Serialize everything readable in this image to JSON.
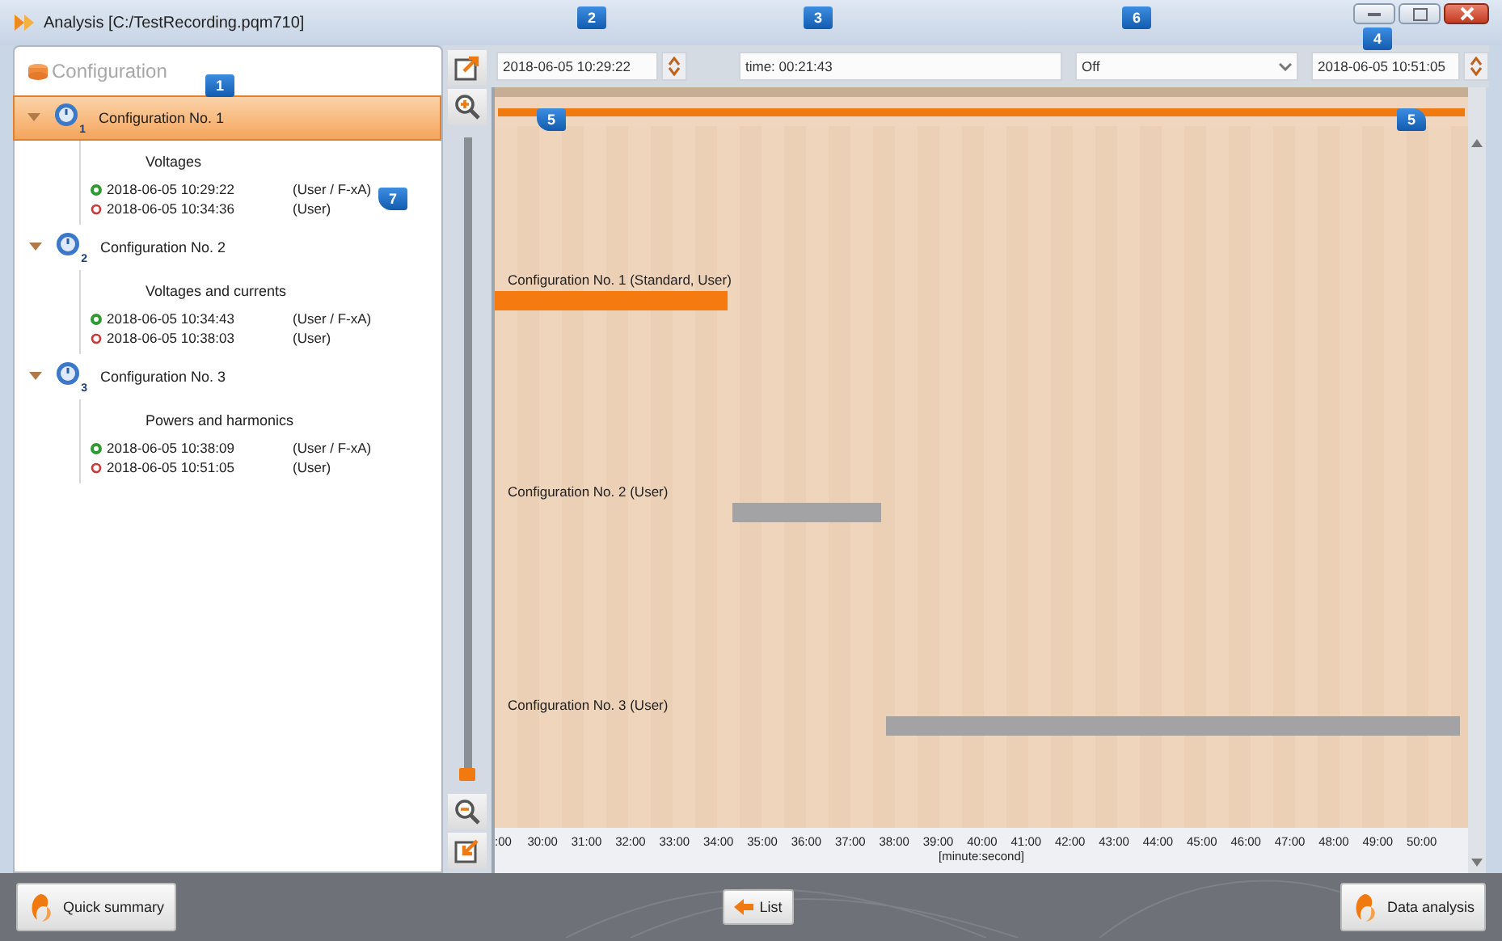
{
  "window": {
    "title": "Analysis [C:/TestRecording.pqm710]"
  },
  "sidebar": {
    "header": "Configuration",
    "items": [
      {
        "label": "Configuration No. 1",
        "number": "1",
        "expanded": true,
        "selected": true,
        "children": [
          {
            "title": "Voltages",
            "entries": [
              {
                "kind": "start",
                "time": "2018-06-05 10:29:22",
                "mode": "(User / F-xA)"
              },
              {
                "kind": "stop",
                "time": "2018-06-05 10:34:36",
                "mode": "(User)"
              }
            ]
          }
        ]
      },
      {
        "label": "Configuration No. 2",
        "number": "2",
        "expanded": true,
        "selected": false,
        "children": [
          {
            "title": "Voltages and currents",
            "entries": [
              {
                "kind": "start",
                "time": "2018-06-05 10:34:43",
                "mode": "(User / F-xA)"
              },
              {
                "kind": "stop",
                "time": "2018-06-05 10:38:03",
                "mode": "(User)"
              }
            ]
          }
        ]
      },
      {
        "label": "Configuration No. 3",
        "number": "3",
        "expanded": true,
        "selected": false,
        "children": [
          {
            "title": "Powers and harmonics",
            "entries": [
              {
                "kind": "start",
                "time": "2018-06-05 10:38:09",
                "mode": "(User / F-xA)"
              },
              {
                "kind": "stop",
                "time": "2018-06-05 10:51:05",
                "mode": "(User)"
              }
            ]
          }
        ]
      }
    ]
  },
  "zoom_slider": {
    "level": 0
  },
  "range_slider": {
    "level": 1
  },
  "toolbar": {
    "range_start": "2018-06-05 10:29:22",
    "duration": "time: 00:21:43",
    "mode": "Off",
    "range_end": "2018-06-05 10:51:05"
  },
  "timeline": {
    "rows": [
      {
        "label": "Configuration No. 1 (Standard, User)",
        "selected": true
      },
      {
        "label": "Configuration No. 2 (User)",
        "selected": false
      },
      {
        "label": "Configuration No. 3 (User)",
        "selected": false
      }
    ],
    "ticks": [
      ":00",
      "30:00",
      "31:00",
      "32:00",
      "33:00",
      "34:00",
      "35:00",
      "36:00",
      "37:00",
      "38:00",
      "39:00",
      "40:00",
      "41:00",
      "42:00",
      "43:00",
      "44:00",
      "45:00",
      "46:00",
      "47:00",
      "48:00",
      "49:00",
      "50:00"
    ],
    "axis_label": "[minute:second]"
  },
  "callouts": [
    "1",
    "2",
    "3",
    "4",
    "5",
    "5",
    "6",
    "7"
  ],
  "footer": {
    "left": "Quick summary",
    "center": "List",
    "right": "Data analysis"
  }
}
